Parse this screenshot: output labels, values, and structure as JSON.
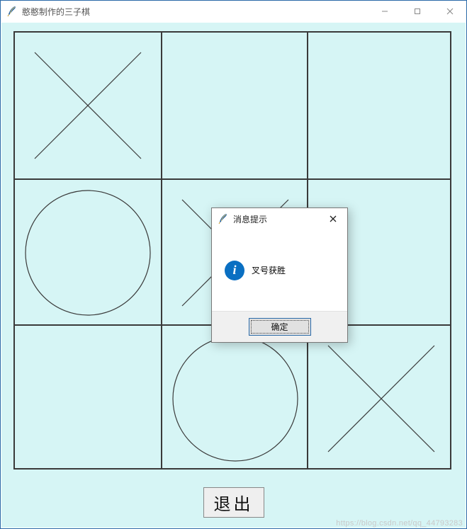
{
  "window": {
    "title": "憨憨制作的三子棋",
    "buttons": {
      "min": "minimize",
      "max": "maximize",
      "close": "close"
    }
  },
  "board": {
    "grid": 3,
    "cells": [
      {
        "row": 0,
        "col": 0,
        "mark": "X"
      },
      {
        "row": 0,
        "col": 1,
        "mark": ""
      },
      {
        "row": 0,
        "col": 2,
        "mark": ""
      },
      {
        "row": 1,
        "col": 0,
        "mark": "O"
      },
      {
        "row": 1,
        "col": 1,
        "mark": "X"
      },
      {
        "row": 1,
        "col": 2,
        "mark": ""
      },
      {
        "row": 2,
        "col": 0,
        "mark": ""
      },
      {
        "row": 2,
        "col": 1,
        "mark": "O"
      },
      {
        "row": 2,
        "col": 2,
        "mark": "X"
      }
    ]
  },
  "exit_label": "退出",
  "dialog": {
    "title": "消息提示",
    "message": "叉号获胜",
    "ok_label": "确定",
    "icon": "info"
  },
  "watermark": "https://blog.csdn.net/qq_44793283",
  "colors": {
    "canvas_bg": "#d6f5f5",
    "grid_line": "#3a3a3a",
    "win_border": "#2a6aa8",
    "info_icon": "#0a6fc2"
  }
}
